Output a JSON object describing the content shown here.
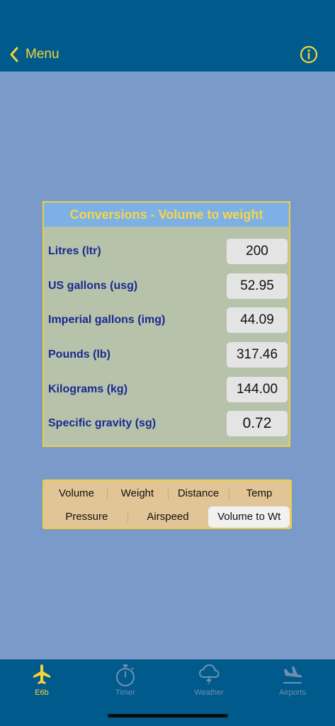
{
  "nav": {
    "back_label": "Menu"
  },
  "card": {
    "title": "Conversions - Volume to weight",
    "rows": [
      {
        "label": "Litres (ltr)",
        "value": "200"
      },
      {
        "label": "US gallons (usg)",
        "value": "52.95"
      },
      {
        "label": "Imperial gallons (img)",
        "value": "44.09"
      },
      {
        "label": "Pounds (lb)",
        "value": "317.46"
      },
      {
        "label": "Kilograms (kg)",
        "value": "144.00"
      },
      {
        "label": "Specific gravity (sg)",
        "value": "0.72"
      }
    ]
  },
  "segments": {
    "row1": [
      "Volume",
      "Weight",
      "Distance",
      "Temp"
    ],
    "row2": [
      "Pressure",
      "Airspeed",
      "Volume to Wt"
    ],
    "selected": "Volume to Wt"
  },
  "tabs": [
    {
      "label": "E6b",
      "icon": "airplane-icon"
    },
    {
      "label": "Timer",
      "icon": "stopwatch-icon"
    },
    {
      "label": "Weather",
      "icon": "thunderstorm-icon"
    },
    {
      "label": "Airports",
      "icon": "airplane-landing-icon"
    }
  ],
  "colors": {
    "accent": "#f5d33a",
    "navbar": "#005b8c",
    "background": "#7a9bc9",
    "tab_inactive": "#6f8fb0"
  }
}
